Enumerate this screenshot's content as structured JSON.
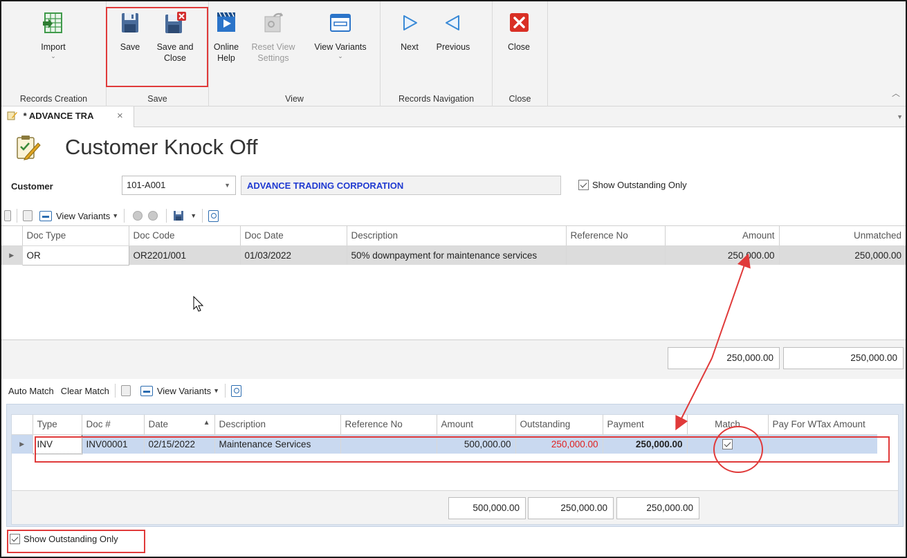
{
  "ribbon": {
    "groups": [
      {
        "label": "Records Creation"
      },
      {
        "label": "Save"
      },
      {
        "label": "View"
      },
      {
        "label": "Records Navigation"
      },
      {
        "label": "Close"
      }
    ],
    "buttons": {
      "import": {
        "line1": "Import",
        "line2": ""
      },
      "save": {
        "line1": "Save",
        "line2": ""
      },
      "save_close": {
        "line1": "Save and",
        "line2": "Close"
      },
      "online_help": {
        "line1": "Online",
        "line2": "Help"
      },
      "reset_view": {
        "line1": "Reset View",
        "line2": "Settings"
      },
      "view_variants": {
        "line1": "View Variants",
        "line2": ""
      },
      "next": {
        "line1": "Next",
        "line2": ""
      },
      "previous": {
        "line1": "Previous",
        "line2": ""
      },
      "close": {
        "line1": "Close",
        "line2": ""
      }
    }
  },
  "tab": {
    "label": "* ADVANCE TRA"
  },
  "page": {
    "title": "Customer Knock Off"
  },
  "customer": {
    "label": "Customer",
    "code": "101-A001",
    "name": "ADVANCE TRADING CORPORATION",
    "show_outstanding_label": "Show Outstanding Only"
  },
  "toolbar1": {
    "view_variants": "View Variants"
  },
  "grid1": {
    "columns": [
      "Doc Type",
      "Doc Code",
      "Doc Date",
      "Description",
      "Reference No",
      "Amount",
      "Unmatched"
    ],
    "rows": [
      {
        "doc_type": "OR",
        "doc_code": "OR2201/001",
        "doc_date": "01/03/2022",
        "description": "50% downpayment for maintenance services",
        "reference_no": "",
        "amount": "250,000.00",
        "unmatched": "250,000.00"
      }
    ],
    "totals": {
      "amount": "250,000.00",
      "unmatched": "250,000.00"
    }
  },
  "toolbar2": {
    "auto_match": "Auto Match",
    "clear_match": "Clear Match",
    "view_variants": "View Variants"
  },
  "grid2": {
    "columns": [
      "Type",
      "Doc #",
      "Date",
      "Description",
      "Reference No",
      "Amount",
      "Outstanding",
      "Payment",
      "Match",
      "Pay For WTax Amount"
    ],
    "rows": [
      {
        "type": "INV",
        "doc_no": "INV00001",
        "date": "02/15/2022",
        "description": "Maintenance Services",
        "reference_no": "",
        "amount": "500,000.00",
        "outstanding": "250,000.00",
        "payment": "250,000.00",
        "match": true,
        "pay_wtax": ""
      }
    ],
    "totals": {
      "amount": "500,000.00",
      "outstanding": "250,000.00",
      "payment": "250,000.00"
    }
  },
  "bottom": {
    "show_outstanding_label": "Show Outstanding Only"
  },
  "colors": {
    "annotation_red": "#e03a3a",
    "customer_name_blue": "#1f3ad1",
    "outstanding_red": "#e02020"
  }
}
